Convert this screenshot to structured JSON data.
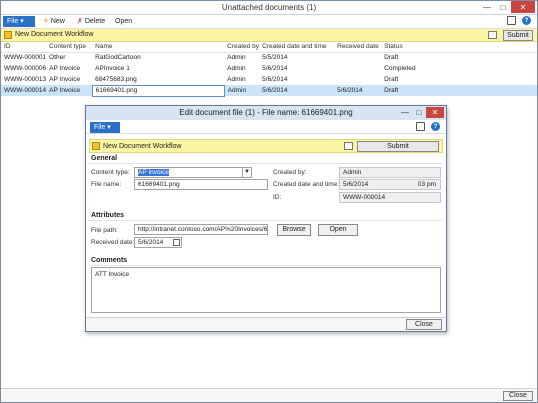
{
  "main": {
    "title": "Unattached documents (1)",
    "ribbon": {
      "file": "File",
      "new": "New",
      "delete": "Delete",
      "open": "Open"
    },
    "workflow": {
      "label": "New Document Workflow",
      "submit": "Submit"
    },
    "columns": [
      "ID",
      "Content type",
      "Name",
      "Created by",
      "Created date and time",
      "Received date",
      "Status"
    ],
    "rows": [
      [
        "WWW-000001",
        "Other",
        "RatGodCartoon",
        "Admin",
        "5/5/2014",
        "",
        "Draft"
      ],
      [
        "WWW-000006",
        "AP Invoice",
        "APInvoice 1",
        "Admin",
        "5/6/2014",
        "",
        "Completed"
      ],
      [
        "WWW-000013",
        "AP Invoice",
        "68475683.png",
        "Admin",
        "5/6/2014",
        "",
        "Draft"
      ],
      [
        "WWW-000014",
        "AP Invoice",
        "61669401.png",
        "Admin",
        "5/6/2014",
        "5/6/2014",
        "Draft"
      ]
    ],
    "close": "Close"
  },
  "dialog": {
    "title": "Edit document file (1) - File name: 61669401.png",
    "file": "File",
    "workflow": {
      "label": "New Document Workflow",
      "submit": "Submit"
    },
    "general": {
      "heading": "General",
      "content_type_label": "Content type:",
      "content_type_value": "AP Invoice",
      "file_name_label": "File name:",
      "file_name_value": "61669401.png",
      "created_by_label": "Created by:",
      "created_by_value": "Admin",
      "created_dt_label": "Created date and time:",
      "created_date_value": "5/6/2014",
      "created_time_value": "03 pm",
      "id_label": "ID:",
      "id_value": "WWW-000014"
    },
    "attributes": {
      "heading": "Attributes",
      "file_path_label": "File path:",
      "file_path_value": "http://intranet.contoso.com/AP%20Invoices/6",
      "browse": "Browse",
      "open": "Open",
      "received_date_label": "Received date:",
      "received_date_value": "5/6/2014"
    },
    "comments": {
      "heading": "Comments",
      "value": "ATT Invoice"
    },
    "close": "Close"
  }
}
